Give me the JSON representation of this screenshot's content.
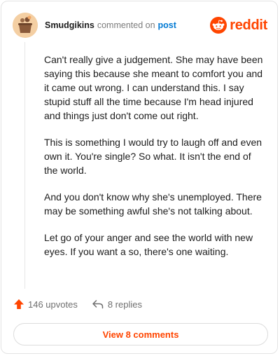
{
  "comment": {
    "author": "Smudgikins",
    "verb": "commented on",
    "target": "post",
    "brand": "reddit",
    "paragraphs": [
      "Can't really give a judgement. She may have been saying this because she meant to comfort you and it came out wrong. I can understand this. I say stupid stuff all the time because I'm head injured and things just don't come out right.",
      "This is something I would try to laugh off and even own it. You're single? So what. It isn't the end of the world.",
      "And you don't know why she's unemployed. There may be something awful she's not talking about.",
      "Let go of your anger and see the world with new eyes. If you want a so, there's one waiting."
    ]
  },
  "actions": {
    "upvotes_label": "146 upvotes",
    "replies_label": "8 replies",
    "view_comments_label": "View 8 comments"
  },
  "colors": {
    "brand_orange": "#ff4500",
    "link_blue": "#0079d3",
    "muted_text": "#6f6f6f"
  },
  "icons": {
    "avatar": "user-avatar",
    "brand": "reddit-logo-icon",
    "upvote": "upvote-arrow-icon",
    "reply": "reply-arrow-icon"
  }
}
